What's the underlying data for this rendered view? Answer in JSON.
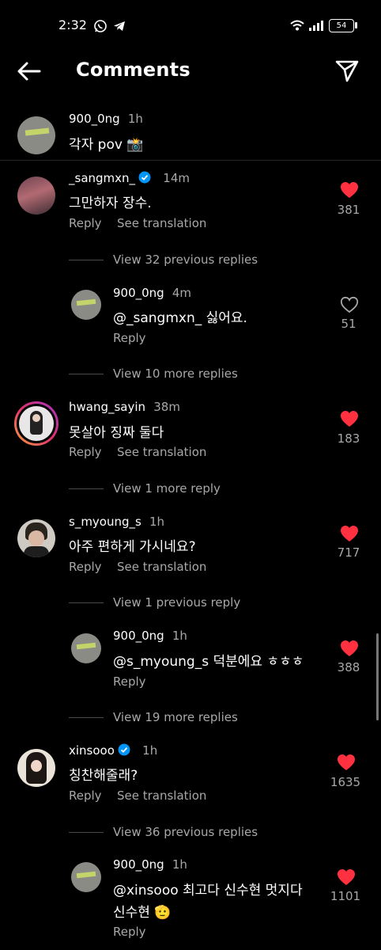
{
  "status_bar": {
    "time": "2:32",
    "battery": "54"
  },
  "header": {
    "title": "Comments"
  },
  "caption": {
    "username": "900_0ng",
    "time": "1h",
    "text": "각자 pov 📸"
  },
  "actions": {
    "reply": "Reply",
    "see_translation": "See translation"
  },
  "comments": [
    {
      "username": "_sangmxn_",
      "verified": true,
      "time": "14m",
      "text": "그만하자 장수.",
      "likes": "381",
      "liked": true
    },
    {
      "username": "hwang_sayin",
      "time": "38m",
      "text": "못살아 징짜 둘다",
      "likes": "183",
      "liked": true
    },
    {
      "username": "s_myoung_s",
      "time": "1h",
      "text": "아주 편하게 가시네요?",
      "likes": "717",
      "liked": true
    },
    {
      "username": "xinsooo",
      "verified": true,
      "time": "1h",
      "text": "칭찬해줄래?",
      "likes": "1635",
      "liked": true
    }
  ],
  "replies": [
    {
      "username": "900_0ng",
      "time": "4m",
      "text": "@_sangmxn_ 싫어요.",
      "likes": "51",
      "liked": false
    },
    {
      "username": "900_0ng",
      "time": "1h",
      "text": "@s_myoung_s 덕분에요 ㅎㅎㅎ",
      "likes": "388",
      "liked": true
    },
    {
      "username": "900_0ng",
      "time": "1h",
      "text_line1": "@xinsooo 최고다 신수현 멋지다",
      "text_line2": "신수현 🫡",
      "likes": "1101",
      "liked": true
    }
  ],
  "view_links": [
    "View 32 previous replies",
    "View 10 more replies",
    "View 1 more reply",
    "View 1 previous reply",
    "View 19 more replies",
    "View 36 previous replies"
  ],
  "colors": {
    "background": "#000000",
    "like_red": "#ff3040",
    "muted": "#a8a8a8",
    "verified_blue": "#0095f6"
  }
}
